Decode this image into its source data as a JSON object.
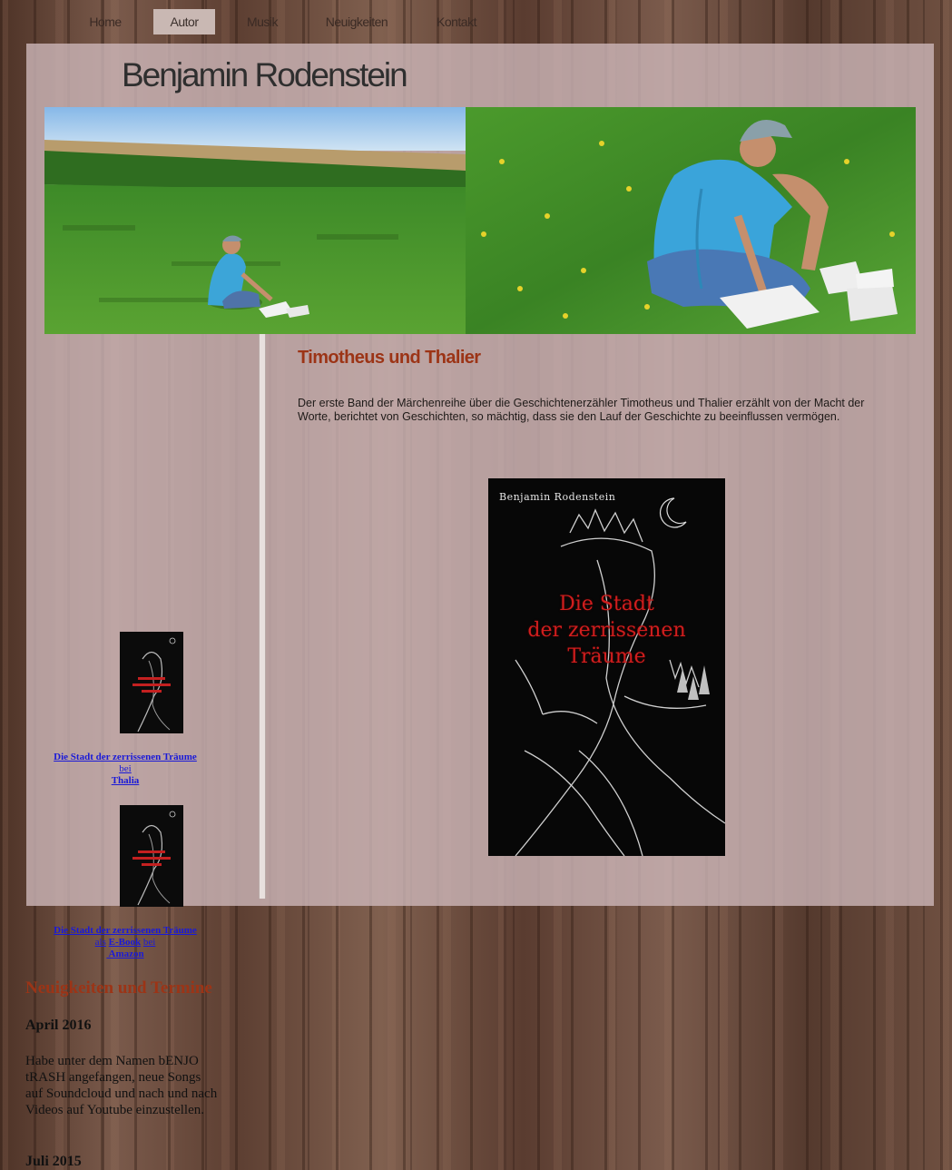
{
  "nav": {
    "items": [
      {
        "label": "Home"
      },
      {
        "label": "Autor"
      },
      {
        "label": "Musik"
      },
      {
        "label": "Neuigkeiten"
      },
      {
        "label": "Kontakt"
      }
    ],
    "active": "Autor"
  },
  "header": {
    "site_title": "Benjamin Rodenstein"
  },
  "sidebar": {
    "books": [
      {
        "title": "Die Stadt der zerrissenen Träume",
        "prefix": "bei",
        "store": "Thalia"
      },
      {
        "title": "Die Stadt der zerrissenen Träume",
        "prefix": "als",
        "format": "E-Book",
        "prefix2": "bei",
        "store": " Amazon"
      }
    ],
    "news_heading": "Neuigkeiten und Termine",
    "news": [
      {
        "date": "April 2016",
        "text": "Habe unter dem Namen bENJO tRASH angefangen, neue Songs auf Soundcloud und nach und nach Videos auf Youtube einzustellen."
      },
      {
        "date": "Juli 2015"
      }
    ]
  },
  "main": {
    "title": "Timotheus und Thalier",
    "text": " Der erste Band der Märchenreihe über die Geschichtenerzähler Timotheus und Thalier erzählt von der Macht der Worte, berichtet von Geschichten, so mächtig, dass sie den Lauf der Geschichte zu beeinflussen vermögen.",
    "cover": {
      "author": "Benjamin Rodenstein",
      "title_lines": [
        "Die Stadt",
        "der zerrissenen",
        "Träume"
      ]
    }
  },
  "colors": {
    "accent": "#9c3416",
    "link": "#1a1ad8"
  }
}
